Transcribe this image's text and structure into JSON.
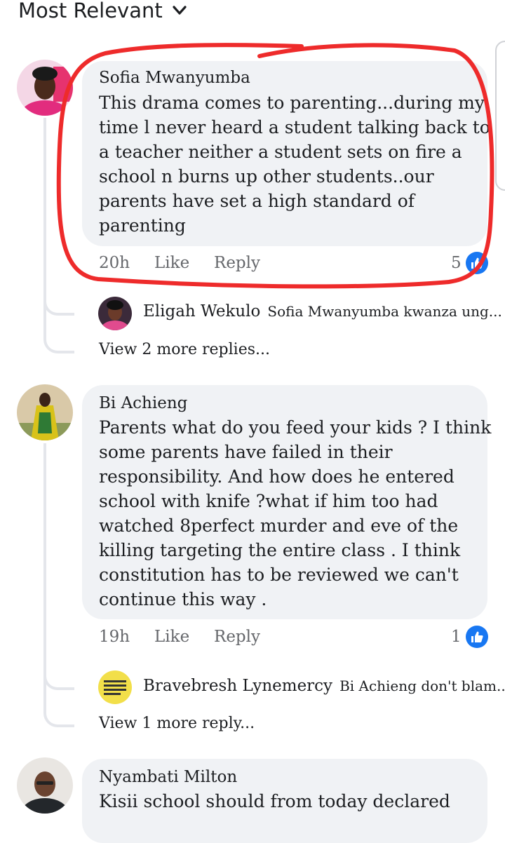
{
  "header": {
    "sort_label": "Most Relevant"
  },
  "comments": [
    {
      "author": "Sofia Mwanyumba",
      "text": "This drama comes to parenting...during my\ntime l never heard a student talking back to\na teacher neither a student sets on fire a\nschool n burns up other students..our\nparents have set  a high standard of\nparenting",
      "time": "20h",
      "like_label": "Like",
      "reply_label": "Reply",
      "likes": "5",
      "reply_preview": {
        "author": "Eligah Wekulo",
        "text": "Sofia Mwanyumba kwanza ung..."
      },
      "view_more": "View 2 more replies..."
    },
    {
      "author": "Bi Achieng",
      "text": "Parents what do you feed your kids ? I think\nsome parents have failed in their\nresponsibility. And how does he entered\nschool with knife ?what if him too had\nwatched 8perfect murder and eve of the\nkilling targeting the entire class  .  I think\nconstitution has to be reviewed we can't\ncontinue this  way .",
      "time": "19h",
      "like_label": "Like",
      "reply_label": "Reply",
      "likes": "1",
      "reply_preview": {
        "author": "Bravebresh Lynemercy",
        "text": "Bi Achieng don't blam..."
      },
      "view_more": "View 1 more reply..."
    },
    {
      "author": "Nyambati Milton",
      "text": "Kisii school should from today declared"
    }
  ],
  "colors": {
    "bubble": "#f0f2f5",
    "meta": "#65676b",
    "like_blue": "#1877f2",
    "highlight_red": "#ee2b2b"
  }
}
